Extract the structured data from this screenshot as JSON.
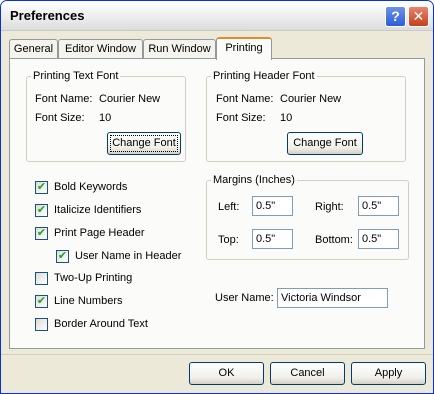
{
  "window": {
    "title": "Preferences",
    "help_glyph": "?",
    "close_glyph": "✕"
  },
  "tabs": [
    {
      "label": "General",
      "active": false
    },
    {
      "label": "Editor Window",
      "active": false
    },
    {
      "label": "Run Window",
      "active": false
    },
    {
      "label": "Printing",
      "active": true
    }
  ],
  "text_font": {
    "group_title": "Printing Text Font",
    "name_label": "Font Name:",
    "name_value": "Courier New",
    "size_label": "Font Size:",
    "size_value": "10",
    "button": "Change Font"
  },
  "header_font": {
    "group_title": "Printing Header Font",
    "name_label": "Font Name:",
    "name_value": "Courier New",
    "size_label": "Font Size:",
    "size_value": "10",
    "button": "Change Font"
  },
  "options": [
    {
      "label": "Bold Keywords",
      "checked": true
    },
    {
      "label": "Italicize Identifiers",
      "checked": true
    },
    {
      "label": "Print Page Header",
      "checked": true
    },
    {
      "label": "User Name in Header",
      "checked": true
    },
    {
      "label": "Two-Up Printing",
      "checked": false
    },
    {
      "label": "Line Numbers",
      "checked": true
    },
    {
      "label": "Border Around Text",
      "checked": false
    }
  ],
  "margins": {
    "group_title": "Margins (Inches)",
    "left_label": "Left:",
    "left_value": "0.5\"",
    "right_label": "Right:",
    "right_value": "0.5\"",
    "top_label": "Top:",
    "top_value": "0.5\"",
    "bottom_label": "Bottom:",
    "bottom_value": "0.5\""
  },
  "user": {
    "label": "User Name:",
    "value": "Victoria Windsor"
  },
  "buttons": {
    "ok": "OK",
    "cancel": "Cancel",
    "apply": "Apply"
  },
  "check_glyph": "✔",
  "colors": {
    "accent_border": "#0831d9",
    "tab_highlight": "#e68b2c",
    "check": "#21a121"
  }
}
